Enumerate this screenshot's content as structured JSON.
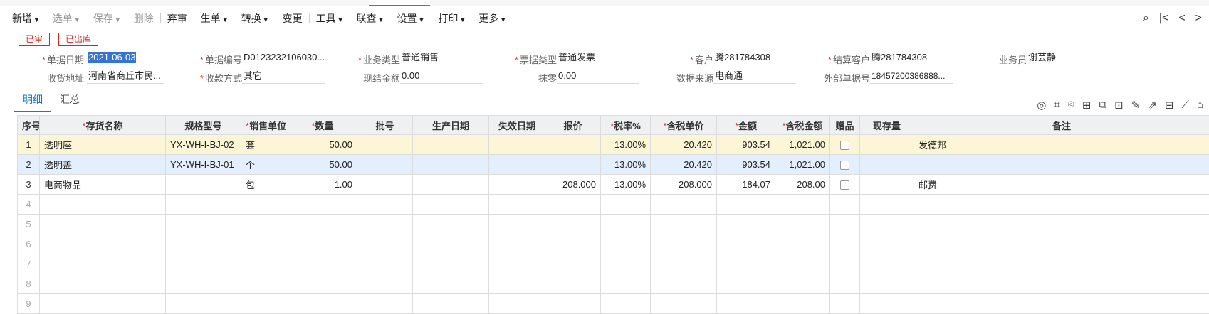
{
  "toolbar": {
    "new": "新增",
    "select_doc": "选单",
    "save": "保存",
    "delete": "删除",
    "abandon": "弃审",
    "generate": "生单",
    "convert": "转换",
    "change": "变更",
    "tools": "工具",
    "linked_query": "联查",
    "settings": "设置",
    "print": "打印",
    "more": "更多"
  },
  "status": {
    "badge1": "已审",
    "badge2": "已出库"
  },
  "form": {
    "doc_date_label": "单据日期",
    "doc_date": "2021-06-03",
    "doc_no_label": "单据编号",
    "doc_no": "D0123232106030...",
    "biz_type_label": "业务类型",
    "biz_type": "普通销售",
    "invoice_type_label": "票据类型",
    "invoice_type": "普通发票",
    "customer_label": "客户",
    "customer": "腾281784308",
    "settle_customer_label": "结算客户",
    "settle_customer": "腾281784308",
    "salesman_label": "业务员",
    "salesman": "谢芸静",
    "address_label": "收货地址",
    "address": "河南省商丘市民...",
    "payment_method_label": "收款方式",
    "payment_method": "其它",
    "cash_amount_label": "现结金额",
    "cash_amount": "0.00",
    "rounding_label": "抹零",
    "rounding": "0.00",
    "data_source_label": "数据来源",
    "data_source": "电商通",
    "external_no_label": "外部单据号",
    "external_no": "18457200386888..."
  },
  "subtabs": {
    "detail": "明细",
    "summary": "汇总"
  },
  "grid": {
    "headers": {
      "idx": "序号",
      "name": "存货名称",
      "spec": "规格型号",
      "unit": "销售单位",
      "qty": "数量",
      "batch": "批号",
      "prod_date": "生产日期",
      "exp_date": "失效日期",
      "quote": "报价",
      "tax_rate": "税率%",
      "unit_price_tax": "含税单价",
      "amount": "金额",
      "amount_tax": "含税金额",
      "gift": "赠品",
      "stock": "现存量",
      "remark": "备注"
    },
    "rows": [
      {
        "idx": "1",
        "name": "透明座",
        "spec": "YX-WH-I-BJ-02",
        "unit": "套",
        "qty": "50.00",
        "quote": "",
        "tax_rate": "13.00%",
        "unit_price_tax": "20.420",
        "amount": "903.54",
        "amount_tax": "1,021.00",
        "remark": "发德邦"
      },
      {
        "idx": "2",
        "name": "透明盖",
        "spec": "YX-WH-I-BJ-01",
        "unit": "个",
        "qty": "50.00",
        "quote": "",
        "tax_rate": "13.00%",
        "unit_price_tax": "20.420",
        "amount": "903.54",
        "amount_tax": "1,021.00",
        "remark": ""
      },
      {
        "idx": "3",
        "name": "电商物品",
        "spec": "",
        "unit": "包",
        "qty": "1.00",
        "quote": "208.000",
        "tax_rate": "13.00%",
        "unit_price_tax": "208.000",
        "amount": "184.07",
        "amount_tax": "208.00",
        "remark": "邮费"
      }
    ],
    "empty_rows": [
      "4",
      "5",
      "6",
      "7",
      "8",
      "9"
    ]
  }
}
